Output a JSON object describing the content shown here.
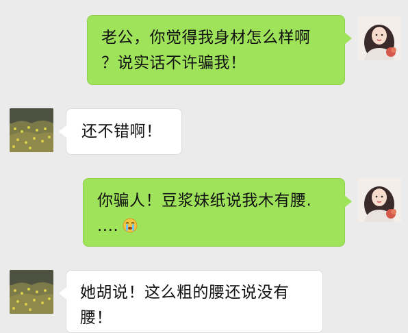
{
  "messages": [
    {
      "sender": "self",
      "avatar_icon": "girl-avatar-icon",
      "lines": [
        "老公，你觉得我身材怎么样啊",
        "？说实话不许骗我！"
      ]
    },
    {
      "sender": "partner",
      "avatar_icon": "landscape-avatar-icon",
      "lines": [
        "还不错啊！"
      ]
    },
    {
      "sender": "self",
      "avatar_icon": "girl-avatar-icon",
      "lines": [
        "你骗人！豆浆妹纸说我木有腰.",
        "...."
      ],
      "trailing_emoji": "crying-emoji-icon"
    },
    {
      "sender": "partner",
      "avatar_icon": "landscape-avatar-icon",
      "lines": [
        "她胡说！这么粗的腰还说没有",
        "腰！"
      ]
    }
  ],
  "colors": {
    "background": "#ebebeb",
    "outgoing_bubble": "#9ee35a",
    "incoming_bubble": "#ffffff"
  }
}
